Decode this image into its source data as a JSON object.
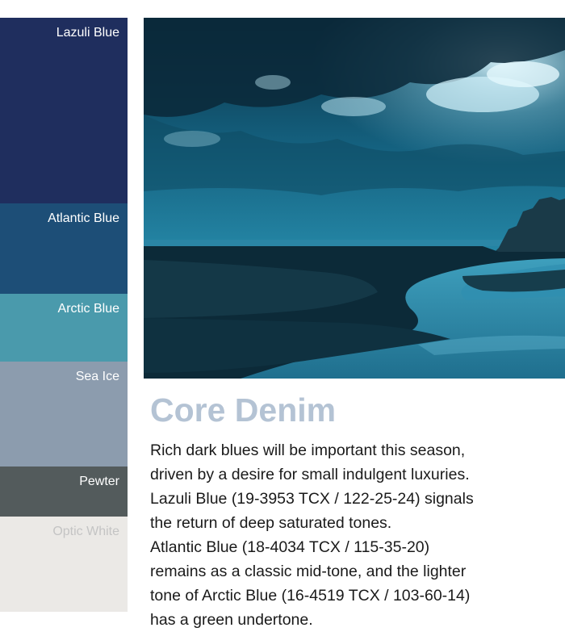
{
  "palette": {
    "swatches": [
      {
        "name": "Lazuli Blue",
        "color": "#1f2e5e",
        "text_color": "#ffffff"
      },
      {
        "name": "Atlantic Blue",
        "color": "#1d4e77",
        "text_color": "#ffffff"
      },
      {
        "name": "Arctic Blue",
        "color": "#4a9aac",
        "text_color": "#ffffff"
      },
      {
        "name": "Sea Ice",
        "color": "#8c9cae",
        "text_color": "#ffffff"
      },
      {
        "name": "Pewter",
        "color": "#535b5c",
        "text_color": "#ffffff"
      },
      {
        "name": "Optic White",
        "color": "#ebe9e6",
        "text_color": "#c4c4c4"
      }
    ]
  },
  "article": {
    "title": "Core Denim",
    "title_color": "#b4c3d4",
    "lines": [
      "Rich dark blues will be important this season,",
      "driven by a desire for small indulgent luxuries.",
      "Lazuli Blue (19-3953 TCX / 122-25-24) signals",
      "the return of deep saturated tones.",
      "Atlantic Blue (18-4034 TCX / 115-35-20)",
      "remains as a classic mid-tone, and the lighter",
      "tone of Arctic Blue (16-4519 TCX / 103-60-14)",
      "has a green undertone."
    ]
  }
}
